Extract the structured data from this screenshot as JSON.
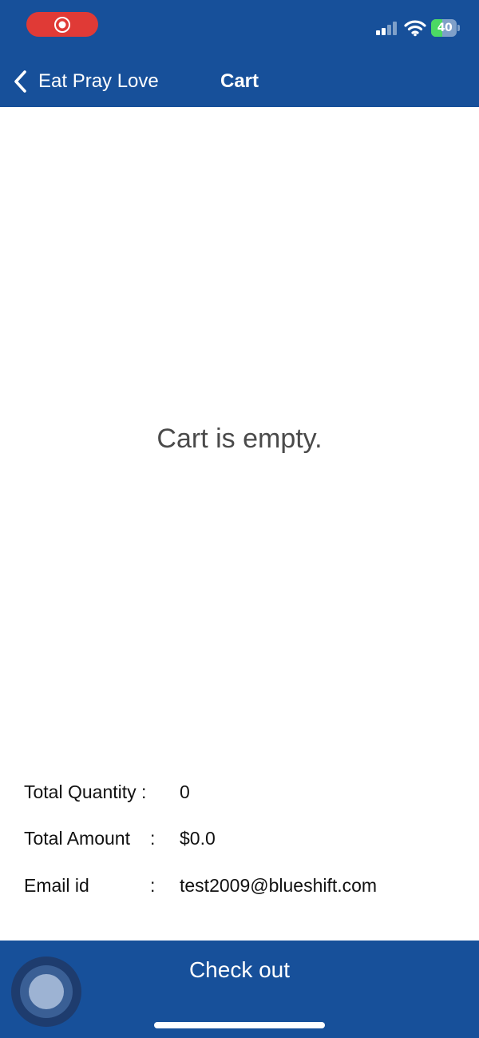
{
  "status_bar": {
    "battery_level": "40",
    "battery_color": "#4cd964",
    "recording_color": "#e03a36",
    "icons": [
      "screen-record-icon",
      "cellular-signal-icon",
      "wifi-icon",
      "battery-icon"
    ]
  },
  "nav": {
    "back_label": "Eat Pray Love",
    "title": "Cart",
    "bar_color": "#17509a"
  },
  "cart": {
    "empty_message": "Cart is empty."
  },
  "summary": {
    "total_quantity_label": "Total Quantity :",
    "total_quantity_value": "0",
    "total_amount_label": "Total Amount",
    "total_amount_colon": ":",
    "total_amount_value": "$0.0",
    "email_label": "Email id",
    "email_colon": ":",
    "email_value": "test2009@blueshift.com"
  },
  "footer": {
    "checkout_label": "Check out",
    "icons": [
      "assistive-touch-icon"
    ]
  }
}
